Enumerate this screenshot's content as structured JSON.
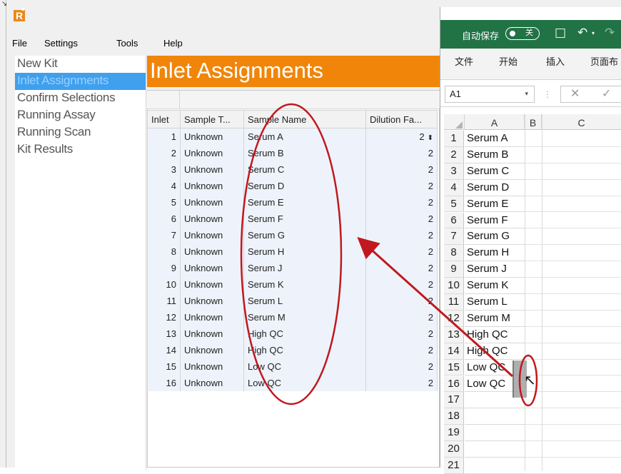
{
  "app": {
    "logo": "R",
    "corner_glyph": "↘",
    "menu": {
      "file": "File",
      "settings": "Settings",
      "tools": "Tools",
      "help": "Help"
    },
    "sidebar": {
      "items": [
        {
          "label": "New Kit",
          "active": false
        },
        {
          "label": "Inlet Assignments",
          "active": true
        },
        {
          "label": "Confirm Selections",
          "active": false
        },
        {
          "label": "Running Assay",
          "active": false
        },
        {
          "label": "Running Scan",
          "active": false
        },
        {
          "label": "Kit Results",
          "active": false
        }
      ]
    },
    "page_title": "Inlet Assignments",
    "table": {
      "headers": {
        "inlet": "Inlet",
        "type": "Sample T...",
        "name": "Sample Name",
        "dilution": "Dilution Fa..."
      },
      "rows": [
        {
          "inlet": "1",
          "type": "Unknown",
          "name": "Serum A",
          "dilution": "2"
        },
        {
          "inlet": "2",
          "type": "Unknown",
          "name": "Serum B",
          "dilution": "2"
        },
        {
          "inlet": "3",
          "type": "Unknown",
          "name": "Serum C",
          "dilution": "2"
        },
        {
          "inlet": "4",
          "type": "Unknown",
          "name": "Serum D",
          "dilution": "2"
        },
        {
          "inlet": "5",
          "type": "Unknown",
          "name": "Serum E",
          "dilution": "2"
        },
        {
          "inlet": "6",
          "type": "Unknown",
          "name": "Serum F",
          "dilution": "2"
        },
        {
          "inlet": "7",
          "type": "Unknown",
          "name": "Serum G",
          "dilution": "2"
        },
        {
          "inlet": "8",
          "type": "Unknown",
          "name": "Serum H",
          "dilution": "2"
        },
        {
          "inlet": "9",
          "type": "Unknown",
          "name": "Serum J",
          "dilution": "2"
        },
        {
          "inlet": "10",
          "type": "Unknown",
          "name": "Serum K",
          "dilution": "2"
        },
        {
          "inlet": "11",
          "type": "Unknown",
          "name": "Serum L",
          "dilution": "2"
        },
        {
          "inlet": "12",
          "type": "Unknown",
          "name": "Serum M",
          "dilution": "2"
        },
        {
          "inlet": "13",
          "type": "Unknown",
          "name": "High QC",
          "dilution": "2"
        },
        {
          "inlet": "14",
          "type": "Unknown",
          "name": "High QC",
          "dilution": "2"
        },
        {
          "inlet": "15",
          "type": "Unknown",
          "name": "Low QC",
          "dilution": "2"
        },
        {
          "inlet": "16",
          "type": "Unknown",
          "name": "Low QC",
          "dilution": "2"
        }
      ],
      "spinner_glyph": "⬍"
    }
  },
  "excel": {
    "autosave_label": "自动保存",
    "autosave_toggle": "关",
    "save_glyph": "□",
    "undo_glyph": "↶",
    "undo_dropdown_glyph": "▾",
    "redo_glyph": "↷",
    "ribbon_tabs": [
      "文件",
      "开始",
      "插入",
      "页面布"
    ],
    "name_box": "A1",
    "name_box_dropdown": "▾",
    "formula_separator": "⋮",
    "cancel_glyph": "✕",
    "enter_glyph": "✓",
    "columns": [
      "A",
      "B",
      "C"
    ],
    "rows": [
      {
        "num": "1",
        "a": "Serum A"
      },
      {
        "num": "2",
        "a": "Serum B"
      },
      {
        "num": "3",
        "a": "Serum C"
      },
      {
        "num": "4",
        "a": "Serum D"
      },
      {
        "num": "5",
        "a": "Serum E"
      },
      {
        "num": "6",
        "a": "Serum F"
      },
      {
        "num": "7",
        "a": "Serum G"
      },
      {
        "num": "8",
        "a": "Serum H"
      },
      {
        "num": "9",
        "a": "Serum J"
      },
      {
        "num": "10",
        "a": "Serum K"
      },
      {
        "num": "11",
        "a": "Serum L"
      },
      {
        "num": "12",
        "a": "Serum M"
      },
      {
        "num": "13",
        "a": "High QC"
      },
      {
        "num": "14",
        "a": "High QC"
      },
      {
        "num": "15",
        "a": "Low QC"
      },
      {
        "num": "16",
        "a": "Low QC"
      },
      {
        "num": "17",
        "a": ""
      },
      {
        "num": "18",
        "a": ""
      },
      {
        "num": "19",
        "a": ""
      },
      {
        "num": "20",
        "a": ""
      },
      {
        "num": "21",
        "a": ""
      }
    ],
    "cursor_glyph": "↖"
  },
  "colors": {
    "header_orange": "#f0850a",
    "nav_active": "#3fa0ee",
    "excel_green": "#217346",
    "annotation_red": "#c0181e"
  }
}
